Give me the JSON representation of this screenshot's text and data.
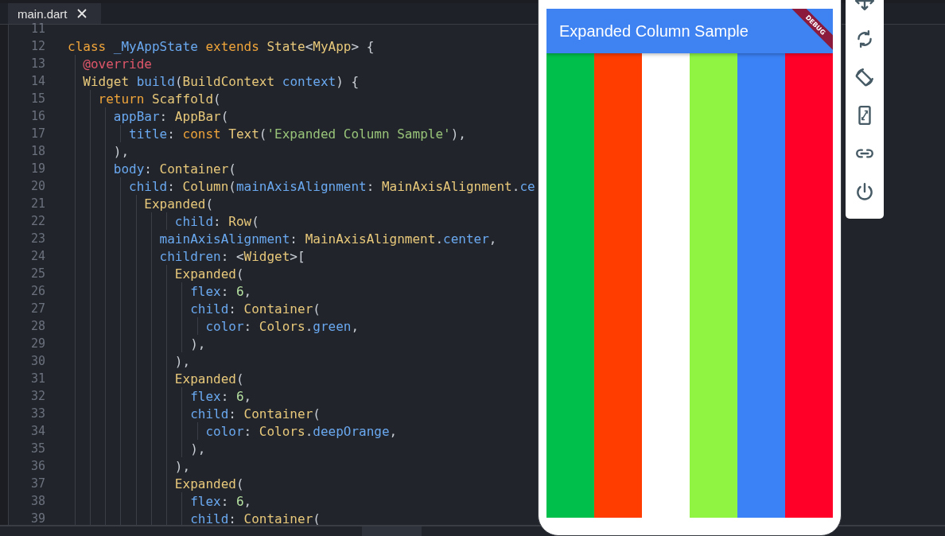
{
  "tabs": [
    {
      "label": "main.dart",
      "selected": true
    }
  ],
  "editor": {
    "lines": [
      {
        "number": "11"
      },
      {
        "number": "12",
        "tokens": [
          {
            "kind": "keyword",
            "text": "class "
          },
          {
            "kind": "name",
            "text": "_MyAppState "
          },
          {
            "kind": "keyword",
            "text": "extends "
          },
          {
            "kind": "type",
            "text": "State"
          },
          {
            "kind": "punct",
            "text": "<"
          },
          {
            "kind": "type",
            "text": "MyApp"
          },
          {
            "kind": "punct",
            "text": "> {"
          }
        ]
      },
      {
        "number": "13",
        "tokens": [
          {
            "kind": "annotation",
            "text": "  @override"
          }
        ]
      },
      {
        "number": "14",
        "tokens": [
          {
            "kind": "type",
            "text": "  Widget "
          },
          {
            "kind": "name",
            "text": "build"
          },
          {
            "kind": "punct",
            "text": "("
          },
          {
            "kind": "type",
            "text": "BuildContext "
          },
          {
            "kind": "name",
            "text": "context"
          },
          {
            "kind": "punct",
            "text": ") {"
          }
        ]
      },
      {
        "number": "15",
        "tokens": [
          {
            "kind": "keyword",
            "text": "    return "
          },
          {
            "kind": "type",
            "text": "Scaffold"
          },
          {
            "kind": "punct",
            "text": "("
          }
        ]
      },
      {
        "number": "16",
        "tokens": [
          {
            "kind": "name",
            "text": "      appBar"
          },
          {
            "kind": "punct",
            "text": ": "
          },
          {
            "kind": "type",
            "text": "AppBar"
          },
          {
            "kind": "punct",
            "text": "("
          }
        ]
      },
      {
        "number": "17",
        "tokens": [
          {
            "kind": "name",
            "text": "        title"
          },
          {
            "kind": "punct",
            "text": ": "
          },
          {
            "kind": "keyword",
            "text": "const "
          },
          {
            "kind": "type",
            "text": "Text"
          },
          {
            "kind": "punct",
            "text": "("
          },
          {
            "kind": "string",
            "text": "'Expanded Column Sample'"
          },
          {
            "kind": "punct",
            "text": "),"
          }
        ]
      },
      {
        "number": "18",
        "tokens": [
          {
            "kind": "punct",
            "text": "      ),"
          }
        ]
      },
      {
        "number": "19",
        "tokens": [
          {
            "kind": "name",
            "text": "      body"
          },
          {
            "kind": "punct",
            "text": ": "
          },
          {
            "kind": "type",
            "text": "Container"
          },
          {
            "kind": "punct",
            "text": "("
          }
        ]
      },
      {
        "number": "20",
        "tokens": [
          {
            "kind": "name",
            "text": "        child"
          },
          {
            "kind": "punct",
            "text": ": "
          },
          {
            "kind": "type",
            "text": "Column"
          },
          {
            "kind": "punct",
            "text": "("
          },
          {
            "kind": "name",
            "text": "mainAxisAlignment"
          },
          {
            "kind": "punct",
            "text": ": "
          },
          {
            "kind": "type",
            "text": "MainAxisAlignment"
          },
          {
            "kind": "punct",
            "text": "."
          },
          {
            "kind": "name",
            "text": "ce"
          }
        ]
      },
      {
        "number": "21",
        "tokens": [
          {
            "kind": "type",
            "text": "          Expanded"
          },
          {
            "kind": "punct",
            "text": "("
          }
        ]
      },
      {
        "number": "22",
        "tokens": [
          {
            "kind": "name",
            "text": "              child"
          },
          {
            "kind": "punct",
            "text": ": "
          },
          {
            "kind": "type",
            "text": "Row"
          },
          {
            "kind": "punct",
            "text": "("
          }
        ]
      },
      {
        "number": "23",
        "tokens": [
          {
            "kind": "name",
            "text": "            mainAxisAlignment"
          },
          {
            "kind": "punct",
            "text": ": "
          },
          {
            "kind": "type",
            "text": "MainAxisAlignment"
          },
          {
            "kind": "punct",
            "text": "."
          },
          {
            "kind": "name",
            "text": "center"
          },
          {
            "kind": "punct",
            "text": ","
          }
        ]
      },
      {
        "number": "24",
        "tokens": [
          {
            "kind": "name",
            "text": "            children"
          },
          {
            "kind": "punct",
            "text": ": <"
          },
          {
            "kind": "type",
            "text": "Widget"
          },
          {
            "kind": "punct",
            "text": ">["
          }
        ]
      },
      {
        "number": "25",
        "tokens": [
          {
            "kind": "type",
            "text": "              Expanded"
          },
          {
            "kind": "punct",
            "text": "("
          }
        ]
      },
      {
        "number": "26",
        "tokens": [
          {
            "kind": "name",
            "text": "                flex"
          },
          {
            "kind": "punct",
            "text": ": "
          },
          {
            "kind": "number",
            "text": "6"
          },
          {
            "kind": "punct",
            "text": ","
          }
        ]
      },
      {
        "number": "27",
        "tokens": [
          {
            "kind": "name",
            "text": "                child"
          },
          {
            "kind": "punct",
            "text": ": "
          },
          {
            "kind": "type",
            "text": "Container"
          },
          {
            "kind": "punct",
            "text": "("
          }
        ]
      },
      {
        "number": "28",
        "tokens": [
          {
            "kind": "name",
            "text": "                  color"
          },
          {
            "kind": "punct",
            "text": ": "
          },
          {
            "kind": "type",
            "text": "Colors"
          },
          {
            "kind": "punct",
            "text": "."
          },
          {
            "kind": "name",
            "text": "green"
          },
          {
            "kind": "punct",
            "text": ","
          }
        ]
      },
      {
        "number": "29",
        "tokens": [
          {
            "kind": "punct",
            "text": "                ),"
          }
        ]
      },
      {
        "number": "30",
        "tokens": [
          {
            "kind": "punct",
            "text": "              ),"
          }
        ]
      },
      {
        "number": "31",
        "tokens": [
          {
            "kind": "type",
            "text": "              Expanded"
          },
          {
            "kind": "punct",
            "text": "("
          }
        ]
      },
      {
        "number": "32",
        "tokens": [
          {
            "kind": "name",
            "text": "                flex"
          },
          {
            "kind": "punct",
            "text": ": "
          },
          {
            "kind": "number",
            "text": "6"
          },
          {
            "kind": "punct",
            "text": ","
          }
        ]
      },
      {
        "number": "33",
        "tokens": [
          {
            "kind": "name",
            "text": "                child"
          },
          {
            "kind": "punct",
            "text": ": "
          },
          {
            "kind": "type",
            "text": "Container"
          },
          {
            "kind": "punct",
            "text": "("
          }
        ]
      },
      {
        "number": "34",
        "tokens": [
          {
            "kind": "name",
            "text": "                  color"
          },
          {
            "kind": "punct",
            "text": ": "
          },
          {
            "kind": "type",
            "text": "Colors"
          },
          {
            "kind": "punct",
            "text": "."
          },
          {
            "kind": "name",
            "text": "deepOrange"
          },
          {
            "kind": "punct",
            "text": ","
          }
        ]
      },
      {
        "number": "35",
        "tokens": [
          {
            "kind": "punct",
            "text": "                ),"
          }
        ]
      },
      {
        "number": "36",
        "tokens": [
          {
            "kind": "punct",
            "text": "              ),"
          }
        ]
      },
      {
        "number": "37",
        "tokens": [
          {
            "kind": "type",
            "text": "              Expanded"
          },
          {
            "kind": "punct",
            "text": "("
          }
        ]
      },
      {
        "number": "38",
        "tokens": [
          {
            "kind": "name",
            "text": "                flex"
          },
          {
            "kind": "punct",
            "text": ": "
          },
          {
            "kind": "number",
            "text": "6"
          },
          {
            "kind": "punct",
            "text": ","
          }
        ]
      },
      {
        "number": "39",
        "tokens": [
          {
            "kind": "name",
            "text": "                child"
          },
          {
            "kind": "punct",
            "text": ": "
          },
          {
            "kind": "type",
            "text": "Container"
          },
          {
            "kind": "punct",
            "text": "("
          }
        ]
      }
    ]
  },
  "preview": {
    "app_bar_title": "Expanded Column Sample",
    "banner": "DEBUG",
    "stripes": [
      {
        "color": "#00c04b"
      },
      {
        "color": "#ff3d00"
      },
      {
        "color": "#ffffff"
      },
      {
        "color": "#8ff542"
      },
      {
        "color": "#3b82f6"
      },
      {
        "color": "#ff0029"
      }
    ]
  }
}
